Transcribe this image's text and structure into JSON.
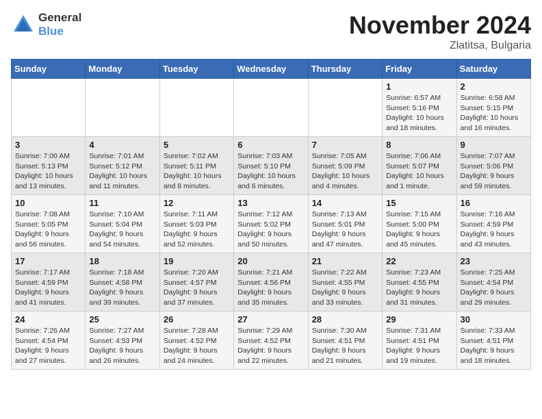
{
  "header": {
    "logo_general": "General",
    "logo_blue": "Blue",
    "month": "November 2024",
    "location": "Zlatitsa, Bulgaria"
  },
  "weekdays": [
    "Sunday",
    "Monday",
    "Tuesday",
    "Wednesday",
    "Thursday",
    "Friday",
    "Saturday"
  ],
  "weeks": [
    [
      {
        "day": "",
        "info": ""
      },
      {
        "day": "",
        "info": ""
      },
      {
        "day": "",
        "info": ""
      },
      {
        "day": "",
        "info": ""
      },
      {
        "day": "",
        "info": ""
      },
      {
        "day": "1",
        "info": "Sunrise: 6:57 AM\nSunset: 5:16 PM\nDaylight: 10 hours\nand 18 minutes."
      },
      {
        "day": "2",
        "info": "Sunrise: 6:58 AM\nSunset: 5:15 PM\nDaylight: 10 hours\nand 16 minutes."
      }
    ],
    [
      {
        "day": "3",
        "info": "Sunrise: 7:00 AM\nSunset: 5:13 PM\nDaylight: 10 hours\nand 13 minutes."
      },
      {
        "day": "4",
        "info": "Sunrise: 7:01 AM\nSunset: 5:12 PM\nDaylight: 10 hours\nand 11 minutes."
      },
      {
        "day": "5",
        "info": "Sunrise: 7:02 AM\nSunset: 5:11 PM\nDaylight: 10 hours\nand 8 minutes."
      },
      {
        "day": "6",
        "info": "Sunrise: 7:03 AM\nSunset: 5:10 PM\nDaylight: 10 hours\nand 6 minutes."
      },
      {
        "day": "7",
        "info": "Sunrise: 7:05 AM\nSunset: 5:09 PM\nDaylight: 10 hours\nand 4 minutes."
      },
      {
        "day": "8",
        "info": "Sunrise: 7:06 AM\nSunset: 5:07 PM\nDaylight: 10 hours\nand 1 minute."
      },
      {
        "day": "9",
        "info": "Sunrise: 7:07 AM\nSunset: 5:06 PM\nDaylight: 9 hours\nand 59 minutes."
      }
    ],
    [
      {
        "day": "10",
        "info": "Sunrise: 7:08 AM\nSunset: 5:05 PM\nDaylight: 9 hours\nand 56 minutes."
      },
      {
        "day": "11",
        "info": "Sunrise: 7:10 AM\nSunset: 5:04 PM\nDaylight: 9 hours\nand 54 minutes."
      },
      {
        "day": "12",
        "info": "Sunrise: 7:11 AM\nSunset: 5:03 PM\nDaylight: 9 hours\nand 52 minutes."
      },
      {
        "day": "13",
        "info": "Sunrise: 7:12 AM\nSunset: 5:02 PM\nDaylight: 9 hours\nand 50 minutes."
      },
      {
        "day": "14",
        "info": "Sunrise: 7:13 AM\nSunset: 5:01 PM\nDaylight: 9 hours\nand 47 minutes."
      },
      {
        "day": "15",
        "info": "Sunrise: 7:15 AM\nSunset: 5:00 PM\nDaylight: 9 hours\nand 45 minutes."
      },
      {
        "day": "16",
        "info": "Sunrise: 7:16 AM\nSunset: 4:59 PM\nDaylight: 9 hours\nand 43 minutes."
      }
    ],
    [
      {
        "day": "17",
        "info": "Sunrise: 7:17 AM\nSunset: 4:59 PM\nDaylight: 9 hours\nand 41 minutes."
      },
      {
        "day": "18",
        "info": "Sunrise: 7:18 AM\nSunset: 4:58 PM\nDaylight: 9 hours\nand 39 minutes."
      },
      {
        "day": "19",
        "info": "Sunrise: 7:20 AM\nSunset: 4:57 PM\nDaylight: 9 hours\nand 37 minutes."
      },
      {
        "day": "20",
        "info": "Sunrise: 7:21 AM\nSunset: 4:56 PM\nDaylight: 9 hours\nand 35 minutes."
      },
      {
        "day": "21",
        "info": "Sunrise: 7:22 AM\nSunset: 4:55 PM\nDaylight: 9 hours\nand 33 minutes."
      },
      {
        "day": "22",
        "info": "Sunrise: 7:23 AM\nSunset: 4:55 PM\nDaylight: 9 hours\nand 31 minutes."
      },
      {
        "day": "23",
        "info": "Sunrise: 7:25 AM\nSunset: 4:54 PM\nDaylight: 9 hours\nand 29 minutes."
      }
    ],
    [
      {
        "day": "24",
        "info": "Sunrise: 7:26 AM\nSunset: 4:54 PM\nDaylight: 9 hours\nand 27 minutes."
      },
      {
        "day": "25",
        "info": "Sunrise: 7:27 AM\nSunset: 4:53 PM\nDaylight: 9 hours\nand 26 minutes."
      },
      {
        "day": "26",
        "info": "Sunrise: 7:28 AM\nSunset: 4:52 PM\nDaylight: 9 hours\nand 24 minutes."
      },
      {
        "day": "27",
        "info": "Sunrise: 7:29 AM\nSunset: 4:52 PM\nDaylight: 9 hours\nand 22 minutes."
      },
      {
        "day": "28",
        "info": "Sunrise: 7:30 AM\nSunset: 4:51 PM\nDaylight: 9 hours\nand 21 minutes."
      },
      {
        "day": "29",
        "info": "Sunrise: 7:31 AM\nSunset: 4:51 PM\nDaylight: 9 hours\nand 19 minutes."
      },
      {
        "day": "30",
        "info": "Sunrise: 7:33 AM\nSunset: 4:51 PM\nDaylight: 9 hours\nand 18 minutes."
      }
    ]
  ]
}
